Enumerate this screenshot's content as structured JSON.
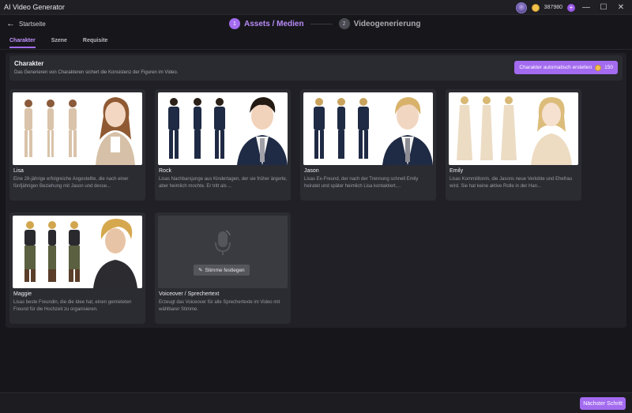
{
  "window": {
    "title": "AI Video Generator",
    "balance": "387980",
    "plus": "+"
  },
  "window_controls": {
    "minimize": "—",
    "maximize": "☐",
    "close": "✕"
  },
  "nav": {
    "back_arrow": "←",
    "back_label": "Startseite"
  },
  "stepper": {
    "steps": [
      {
        "num": "1",
        "label": "Assets / Medien"
      },
      {
        "num": "2",
        "label": "Videogenerierung"
      }
    ]
  },
  "tabs": [
    "Charakter",
    "Szene",
    "Requisite"
  ],
  "character_section": {
    "title": "Charakter",
    "subtitle": "Das Generieren von Charakteren sichert die Konsistenz der Figuren im Video.",
    "auto_button": "Charakter automatisch erstellen",
    "auto_cost": "150"
  },
  "characters": [
    {
      "name": "Lisa",
      "description": "Eine 28-jährige erfolgreiche Angestellte, die nach einer fünfjährigen Beziehung mit Jason und desse..."
    },
    {
      "name": "Rock",
      "description": "Lisas Nachbarsjunge aus Kindertagen, der sie früher ärgerte, aber heimlich mochte. Er tritt als ..."
    },
    {
      "name": "Jason",
      "description": "Lisas Ex-Freund, der nach der Trennung schnell Emily heiratet und später heimlich Lisa kontaktiert,..."
    },
    {
      "name": "Emily",
      "description": "Lisas Kommilitonin, die Jasons neue Verlobte und Ehefrau wird. Sie hat keine aktive Rolle in der Han..."
    },
    {
      "name": "Maggie",
      "description": "Lisas beste Freundin, die die Idee hat, einen gemieteten Freund für die Hochzeit zu organisieren."
    }
  ],
  "voiceover": {
    "button": "Stimme festlegen",
    "title": "Voiceover / Sprechertext",
    "description": "Erzeugt das Voiceover für alle Sprechertexte im Video mit wählbarer Stimme."
  },
  "footer": {
    "next_button": "Nächster Schritt"
  },
  "colors": {
    "accent": "#a36bf0",
    "background": "#17171b",
    "card": "#2b2b32"
  }
}
